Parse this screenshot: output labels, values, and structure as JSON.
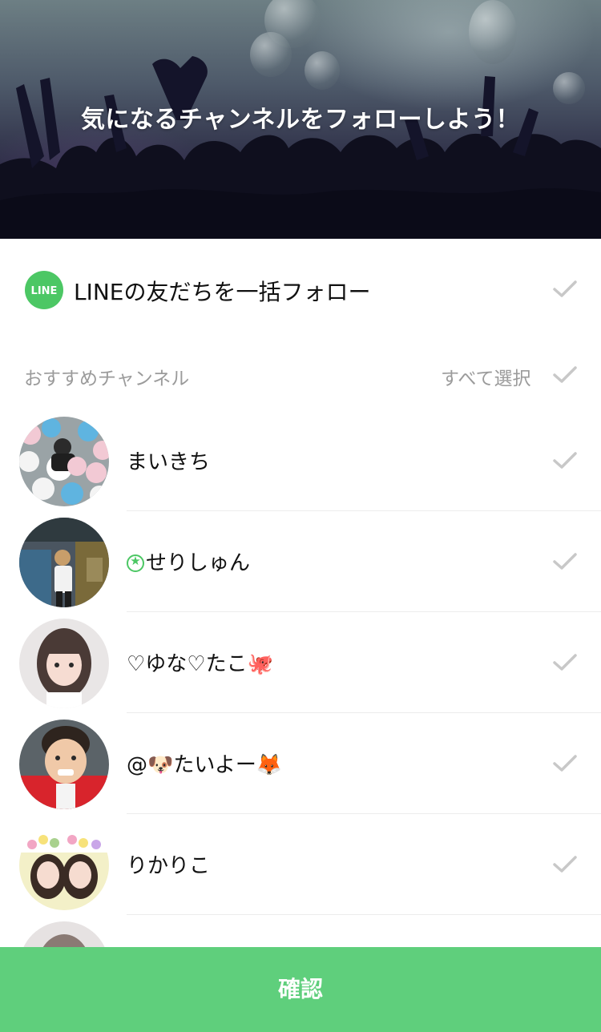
{
  "hero": {
    "title": "気になるチャンネルをフォローしよう！"
  },
  "bulk_follow": {
    "logo_text": "LINE",
    "label": "LINEの友だちを一括フォロー",
    "checked": false
  },
  "section": {
    "title": "おすすめチャンネル",
    "select_all_label": "すべて選択"
  },
  "channels": [
    {
      "name": "まいきち",
      "official": false,
      "checked": false
    },
    {
      "name": "せりしゅん",
      "official": true,
      "checked": false
    },
    {
      "name": "♡ゆな♡たこ🐙",
      "official": false,
      "checked": false
    },
    {
      "name": "@🐶たいよー🦊",
      "official": false,
      "checked": false
    },
    {
      "name": "りかりこ",
      "official": false,
      "checked": false
    }
  ],
  "footer": {
    "confirm_label": "確認"
  },
  "colors": {
    "accent": "#5fcf7c",
    "line_green": "#4cc764",
    "muted_text": "#9b9b9b",
    "check_gray": "#c8c8c8"
  },
  "icons": {
    "check": "check-icon",
    "official_badge": "official-star-icon",
    "line_logo": "line-logo"
  }
}
